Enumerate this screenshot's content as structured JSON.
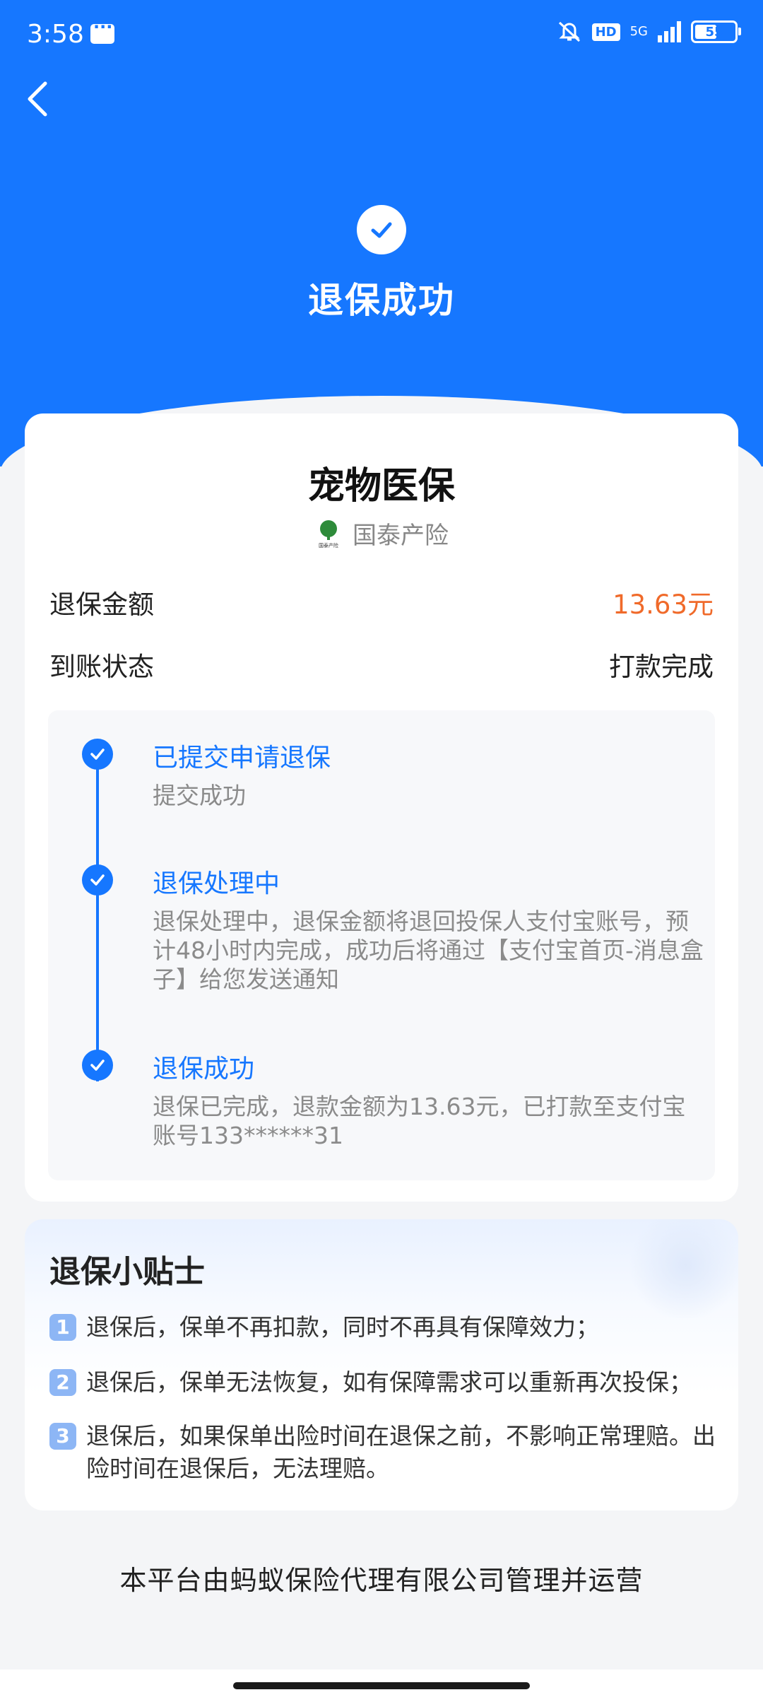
{
  "status_bar": {
    "time": "3:58",
    "network": "5G",
    "hd": "HD",
    "battery": "55"
  },
  "header": {
    "title": "退保成功"
  },
  "product": {
    "name": "宠物医保",
    "insurer": "国泰产险",
    "insurer_logo_text": "国泰产险"
  },
  "info": [
    {
      "label": "退保金额",
      "value": "13.63元"
    },
    {
      "label": "到账状态",
      "value": "打款完成"
    }
  ],
  "timeline": [
    {
      "title": "已提交申请退保",
      "desc": "提交成功"
    },
    {
      "title": "退保处理中",
      "desc": "退保处理中，退保金额将退回投保人支付宝账号，预计48小时内完成，成功后将通过【支付宝首页-消息盒子】给您发送通知"
    },
    {
      "title": "退保成功",
      "desc": "退保已完成，退款金额为13.63元，已打款至支付宝账号133******31"
    }
  ],
  "tips": {
    "title": "退保小贴士",
    "items": [
      {
        "num": "1",
        "text": "退保后，保单不再扣款，同时不再具有保障效力；"
      },
      {
        "num": "2",
        "text": "退保后，保单无法恢复，如有保障需求可以重新再次投保；"
      },
      {
        "num": "3",
        "text": "退保后，如果保单出险时间在退保之前，不影响正常理赔。出险时间在退保后，无法理赔。"
      }
    ]
  },
  "footer": "本平台由蚂蚁保险代理有限公司管理并运营",
  "colors": {
    "brand": "#1677ff",
    "amount": "#f06a2a"
  }
}
